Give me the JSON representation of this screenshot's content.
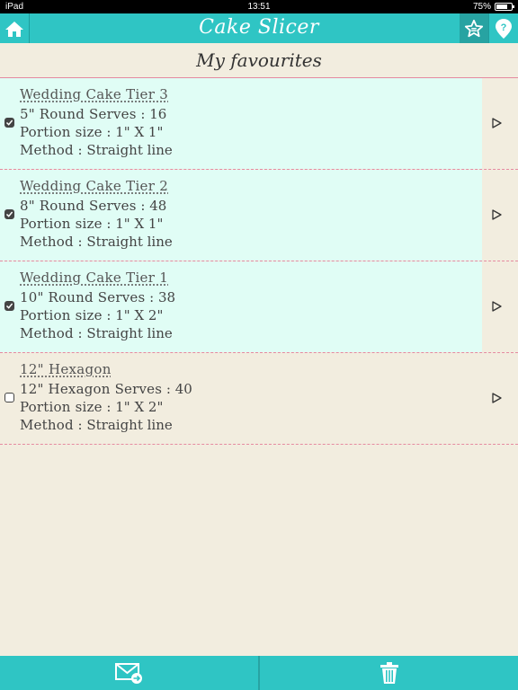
{
  "status_bar": {
    "device": "iPad",
    "time": "13:51",
    "battery": "75%",
    "battery_level": 0.75
  },
  "header": {
    "title": "Cake Slicer"
  },
  "page": {
    "heading": "My favourites"
  },
  "items": [
    {
      "name": "Wedding Cake Tier 3",
      "size_label": "5\" Round Serves",
      "serves": "16",
      "portion_label": "Portion size",
      "portion": "1\" X 1\"",
      "method_label": "Method",
      "method": "Straight line",
      "checked": true
    },
    {
      "name": "Wedding Cake Tier 2",
      "size_label": "8\" Round Serves",
      "serves": "48",
      "portion_label": "Portion size",
      "portion": "1\" X 1\"",
      "method_label": "Method",
      "method": "Straight line",
      "checked": true
    },
    {
      "name": "Wedding Cake Tier 1",
      "size_label": "10\" Round Serves",
      "serves": "38",
      "portion_label": "Portion size",
      "portion": "1\" X 2\"",
      "method_label": "Method",
      "method": "Straight line",
      "checked": true
    },
    {
      "name": "12\" Hexagon",
      "size_label": "12\" Hexagon Serves",
      "serves": "40",
      "portion_label": "Portion size",
      "portion": "1\" X 2\"",
      "method_label": "Method",
      "method": "Straight line",
      "checked": false
    }
  ],
  "icons": {
    "home": "home-icon",
    "favourites": "star-icon",
    "help": "help-icon",
    "email": "email-icon",
    "delete": "trash-icon",
    "open": "play-icon"
  },
  "colors": {
    "accent": "#2fc5c4",
    "background": "#f2eddf",
    "selected_row": "#e0fdf5",
    "divider": "#e58aa0"
  }
}
